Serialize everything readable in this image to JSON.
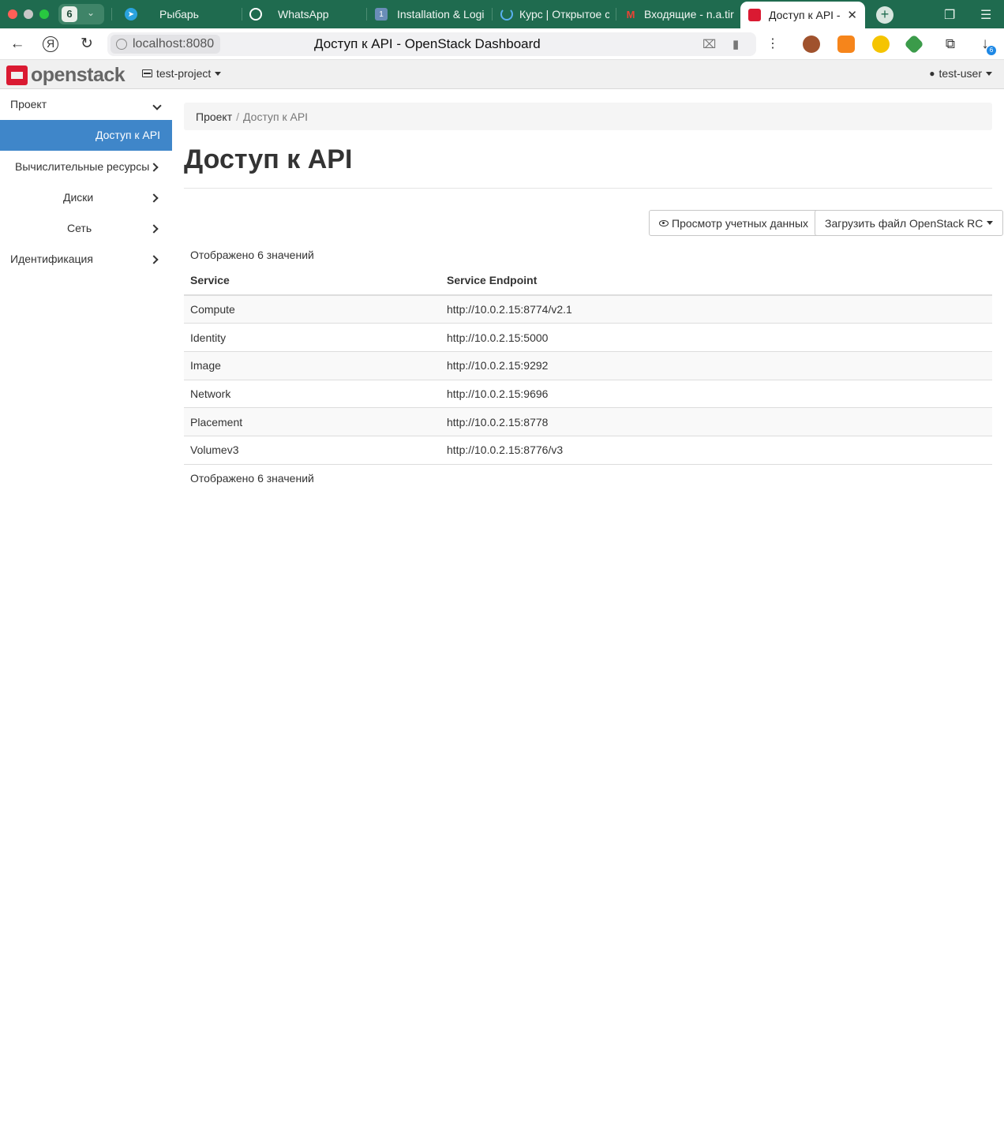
{
  "browser": {
    "tab_group_count": "6",
    "tabs": [
      {
        "label": "Рыбарь",
        "icon": "telegram-icon"
      },
      {
        "label": "WhatsApp",
        "icon": "whatsapp-icon"
      },
      {
        "label": "Installation & Logi",
        "icon": "1password-icon"
      },
      {
        "label": "Курс | Открытое с",
        "icon": "loading-spinner-icon"
      },
      {
        "label": "Входящие - n.a.tir",
        "icon": "gmail-icon"
      },
      {
        "label": "Доступ к API - C",
        "icon": "openstack-icon",
        "active": true
      }
    ],
    "address_host": "localhost:8080",
    "page_title": "Доступ к API - OpenStack Dashboard",
    "downloads_badge": "6"
  },
  "navbar": {
    "logo_text": "openstack",
    "project": "test-project",
    "user": "test-user"
  },
  "sidebar": {
    "section": "Проект",
    "items": [
      {
        "label": "Доступ к API",
        "active": true
      },
      {
        "label": "Вычислительные ресурсы"
      },
      {
        "label": "Диски"
      },
      {
        "label": "Сеть"
      }
    ],
    "identity": "Идентификация"
  },
  "breadcrumb": {
    "root": "Проект",
    "separator": "/",
    "current": "Доступ к API"
  },
  "page": {
    "title": "Доступ к API",
    "view_credentials_label": "Просмотр учетных данных",
    "download_rc_label": "Загрузить файл OpenStack RC",
    "count_text": "Отображено 6 значений"
  },
  "table": {
    "columns": [
      "Service",
      "Service Endpoint"
    ],
    "rows": [
      {
        "service": "Compute",
        "endpoint": "http://10.0.2.15:8774/v2.1"
      },
      {
        "service": "Identity",
        "endpoint": "http://10.0.2.15:5000"
      },
      {
        "service": "Image",
        "endpoint": "http://10.0.2.15:9292"
      },
      {
        "service": "Network",
        "endpoint": "http://10.0.2.15:9696"
      },
      {
        "service": "Placement",
        "endpoint": "http://10.0.2.15:8778"
      },
      {
        "service": "Volumev3",
        "endpoint": "http://10.0.2.15:8776/v3"
      }
    ]
  },
  "colors": {
    "tabstrip": "#1f6b4f",
    "sidebar_active": "#3f86c9",
    "openstack_red": "#da1a32"
  }
}
